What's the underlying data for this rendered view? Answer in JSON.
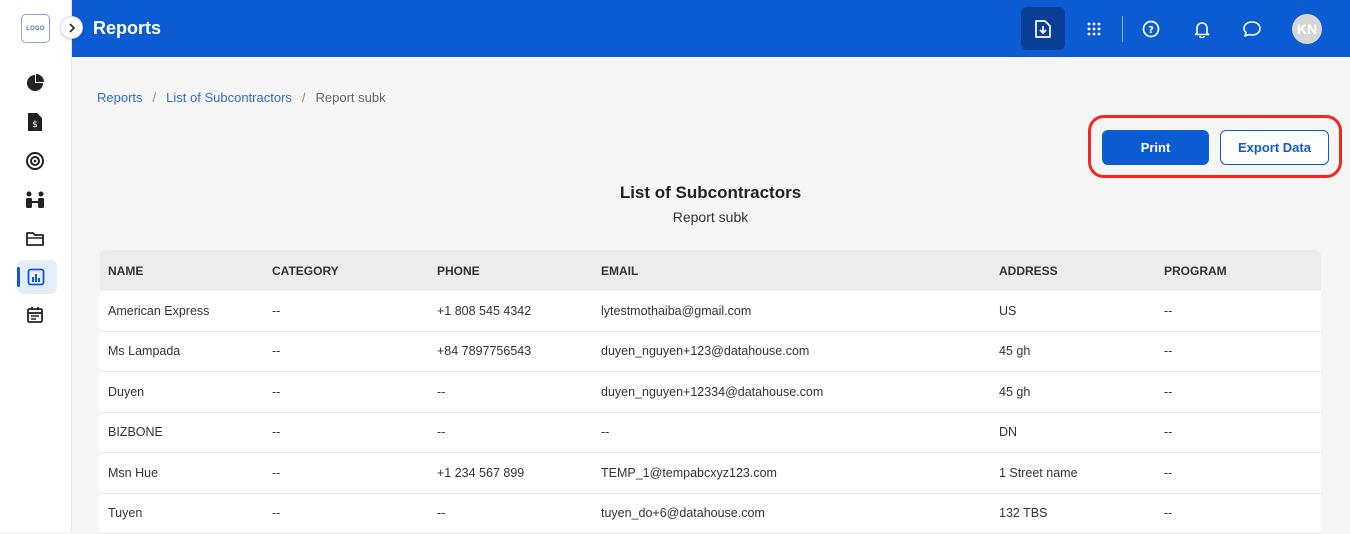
{
  "logo": {
    "text": "LOGO"
  },
  "topbar": {
    "title": "Reports",
    "avatar_initials": "KN"
  },
  "breadcrumb": {
    "items": [
      "Reports",
      "List of Subcontractors",
      "Report subk"
    ],
    "separator": "/"
  },
  "actions": {
    "print_label": "Print",
    "export_label": "Export Data"
  },
  "report": {
    "title": "List of Subcontractors",
    "subtitle": "Report subk"
  },
  "table": {
    "headers": [
      "NAME",
      "CATEGORY",
      "PHONE",
      "EMAIL",
      "ADDRESS",
      "PROGRAM"
    ],
    "rows": [
      [
        "American Express",
        "--",
        "+1 808 545 4342",
        "lytestmothaiba@gmail.com",
        "US",
        "--"
      ],
      [
        "Ms Lampada",
        "--",
        "+84 7897756543",
        "duyen_nguyen+123@datahouse.com",
        "45 gh",
        "--"
      ],
      [
        "Duyen",
        "--",
        "--",
        "duyen_nguyen+12334@datahouse.com",
        "45 gh",
        "--"
      ],
      [
        "BIZBONE",
        "--",
        "--",
        "--",
        "DN",
        "--"
      ],
      [
        "Msn Hue",
        "--",
        "+1 234 567 899",
        "TEMP_1@tempabcxyz123.com",
        "1 Street name",
        "--"
      ],
      [
        "Tuyen",
        "--",
        "--",
        "tuyen_do+6@datahouse.com",
        "132 TBS",
        "--"
      ]
    ]
  },
  "colors": {
    "primary": "#0b5bd3",
    "highlight": "#f2281f",
    "topbar_active": "#0a3f98"
  },
  "icons": {
    "sidebar": [
      "pie-chart-icon",
      "invoice-icon",
      "target-icon",
      "team-icon",
      "folder-icon",
      "report-chart-icon",
      "calendar-icon"
    ],
    "topbar": [
      "download-icon",
      "apps-grid-icon",
      "help-icon",
      "bell-icon",
      "chat-icon"
    ]
  }
}
